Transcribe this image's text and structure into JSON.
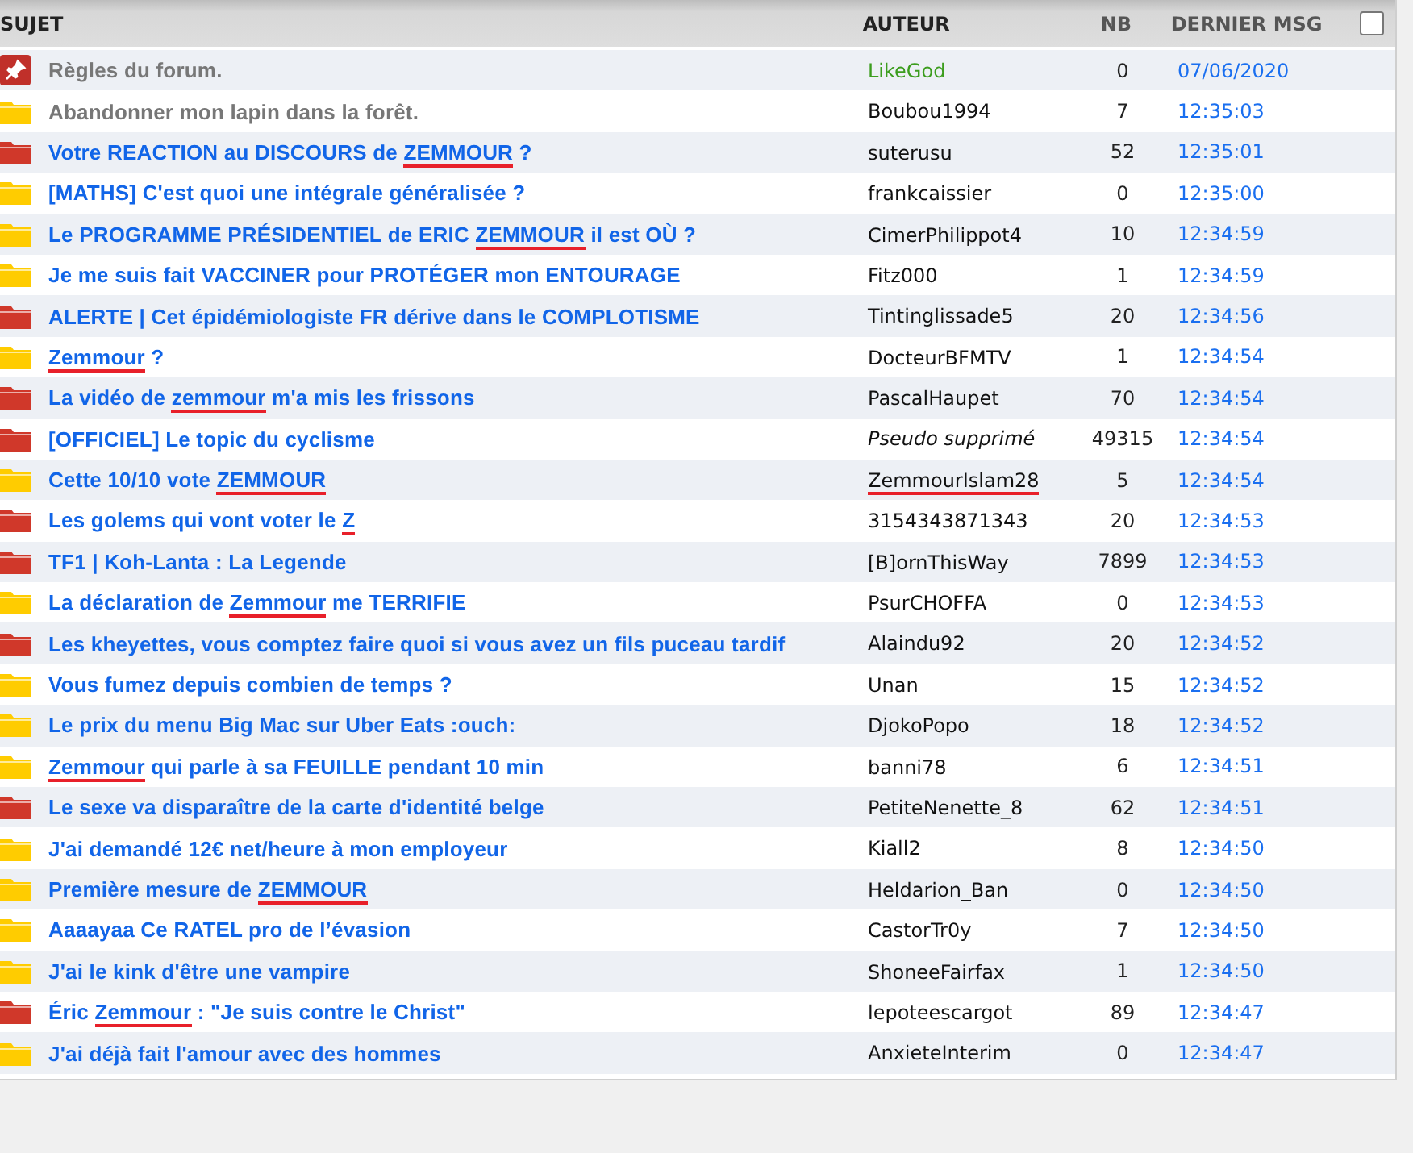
{
  "table": {
    "columns": [
      "SUJET",
      "AUTEUR",
      "NB",
      "DERNIER MSG"
    ],
    "select_all": {
      "checked": false
    },
    "rows": [
      {
        "kind": "pinned",
        "muted": true,
        "title": [
          {
            "text": "Règles du forum.",
            "flagged": false
          }
        ],
        "author": "LikeGod",
        "author_admin": true,
        "author_deleted": false,
        "author_flagged": false,
        "count": "0",
        "last": "07/06/2020"
      },
      {
        "kind": "folder_yellow",
        "muted": true,
        "title": [
          {
            "text": "Abandonner mon lapin dans la forêt.",
            "flagged": false
          }
        ],
        "author": "Boubou1994",
        "author_admin": false,
        "author_deleted": false,
        "author_flagged": false,
        "count": "7",
        "last": "12:35:03"
      },
      {
        "kind": "folder_red",
        "muted": false,
        "title": [
          {
            "text": "Votre REACTION au DISCOURS de ",
            "flagged": false
          },
          {
            "text": "ZEMMOUR",
            "flagged": true
          },
          {
            "text": " ?",
            "flagged": false
          }
        ],
        "author": "suterusu",
        "author_admin": false,
        "author_deleted": false,
        "author_flagged": false,
        "count": "52",
        "last": "12:35:01"
      },
      {
        "kind": "folder_yellow",
        "muted": false,
        "title": [
          {
            "text": "[MATHS] C'est quoi une intégrale généralisée ?",
            "flagged": false
          }
        ],
        "author": "frankcaissier",
        "author_admin": false,
        "author_deleted": false,
        "author_flagged": false,
        "count": "0",
        "last": "12:35:00"
      },
      {
        "kind": "folder_yellow",
        "muted": false,
        "title": [
          {
            "text": "Le PROGRAMME PRÉSIDENTIEL de ERIC ",
            "flagged": false
          },
          {
            "text": "ZEMMOUR",
            "flagged": true
          },
          {
            "text": " il est OÙ ?",
            "flagged": false
          }
        ],
        "author": "CimerPhilippot4",
        "author_admin": false,
        "author_deleted": false,
        "author_flagged": false,
        "count": "10",
        "last": "12:34:59"
      },
      {
        "kind": "folder_yellow",
        "muted": false,
        "title": [
          {
            "text": "Je me suis fait VACCINER pour PROTÉGER mon ENTOURAGE",
            "flagged": false
          }
        ],
        "author": "Fitz000",
        "author_admin": false,
        "author_deleted": false,
        "author_flagged": false,
        "count": "1",
        "last": "12:34:59"
      },
      {
        "kind": "folder_red",
        "muted": false,
        "title": [
          {
            "text": "ALERTE | Cet épidémiologiste FR dérive dans le COMPLOTISME",
            "flagged": false
          }
        ],
        "author": "Tintinglissade5",
        "author_admin": false,
        "author_deleted": false,
        "author_flagged": false,
        "count": "20",
        "last": "12:34:56"
      },
      {
        "kind": "folder_yellow",
        "muted": false,
        "title": [
          {
            "text": "Zemmour",
            "flagged": true
          },
          {
            "text": " ?",
            "flagged": false
          }
        ],
        "author": "DocteurBFMTV",
        "author_admin": false,
        "author_deleted": false,
        "author_flagged": false,
        "count": "1",
        "last": "12:34:54"
      },
      {
        "kind": "folder_red",
        "muted": false,
        "title": [
          {
            "text": "La vidéo de ",
            "flagged": false
          },
          {
            "text": "zemmour",
            "flagged": true
          },
          {
            "text": " m'a mis les frissons",
            "flagged": false
          }
        ],
        "author": "PascalHaupet",
        "author_admin": false,
        "author_deleted": false,
        "author_flagged": false,
        "count": "70",
        "last": "12:34:54"
      },
      {
        "kind": "folder_red",
        "muted": false,
        "title": [
          {
            "text": "[OFFICIEL] Le topic du cyclisme",
            "flagged": false
          }
        ],
        "author": "Pseudo supprimé",
        "author_admin": false,
        "author_deleted": true,
        "author_flagged": false,
        "count": "49315",
        "last": "12:34:54"
      },
      {
        "kind": "folder_yellow",
        "muted": false,
        "title": [
          {
            "text": "Cette 10/10 vote ",
            "flagged": false
          },
          {
            "text": "ZEMMOUR",
            "flagged": true
          }
        ],
        "author": "ZemmourIslam28",
        "author_admin": false,
        "author_deleted": false,
        "author_flagged": true,
        "count": "5",
        "last": "12:34:54"
      },
      {
        "kind": "folder_red",
        "muted": false,
        "title": [
          {
            "text": "Les golems qui vont voter le ",
            "flagged": false
          },
          {
            "text": "Z",
            "flagged": true
          }
        ],
        "author": "3154343871343",
        "author_admin": false,
        "author_deleted": false,
        "author_flagged": false,
        "count": "20",
        "last": "12:34:53"
      },
      {
        "kind": "folder_red",
        "muted": false,
        "title": [
          {
            "text": "TF1 | Koh-Lanta : La Legende",
            "flagged": false
          }
        ],
        "author": "[B]ornThisWay",
        "author_admin": false,
        "author_deleted": false,
        "author_flagged": false,
        "count": "7899",
        "last": "12:34:53"
      },
      {
        "kind": "folder_yellow",
        "muted": false,
        "title": [
          {
            "text": "La déclaration de ",
            "flagged": false
          },
          {
            "text": "Zemmour",
            "flagged": true
          },
          {
            "text": " me TERRIFIE",
            "flagged": false
          }
        ],
        "author": "PsurCHOFFA",
        "author_admin": false,
        "author_deleted": false,
        "author_flagged": false,
        "count": "0",
        "last": "12:34:53"
      },
      {
        "kind": "folder_red",
        "muted": false,
        "title": [
          {
            "text": "Les kheyettes, vous comptez faire quoi si vous avez un fils puceau tardif",
            "flagged": false
          }
        ],
        "author": "Alaindu92",
        "author_admin": false,
        "author_deleted": false,
        "author_flagged": false,
        "count": "20",
        "last": "12:34:52"
      },
      {
        "kind": "folder_yellow",
        "muted": false,
        "title": [
          {
            "text": "Vous fumez depuis combien de temps ?",
            "flagged": false
          }
        ],
        "author": "Unan",
        "author_admin": false,
        "author_deleted": false,
        "author_flagged": false,
        "count": "15",
        "last": "12:34:52"
      },
      {
        "kind": "folder_yellow",
        "muted": false,
        "title": [
          {
            "text": "Le prix du menu Big Mac sur Uber Eats :ouch:",
            "flagged": false
          }
        ],
        "author": "DjokoPopo",
        "author_admin": false,
        "author_deleted": false,
        "author_flagged": false,
        "count": "18",
        "last": "12:34:52"
      },
      {
        "kind": "folder_yellow",
        "muted": false,
        "title": [
          {
            "text": "Zemmour",
            "flagged": true
          },
          {
            "text": " qui parle à sa FEUILLE pendant 10 min",
            "flagged": false
          }
        ],
        "author": "banni78",
        "author_admin": false,
        "author_deleted": false,
        "author_flagged": false,
        "count": "6",
        "last": "12:34:51"
      },
      {
        "kind": "folder_red",
        "muted": false,
        "title": [
          {
            "text": "Le sexe va disparaître de la carte d'identité belge",
            "flagged": false
          }
        ],
        "author": "PetiteNenette_8",
        "author_admin": false,
        "author_deleted": false,
        "author_flagged": false,
        "count": "62",
        "last": "12:34:51"
      },
      {
        "kind": "folder_yellow",
        "muted": false,
        "title": [
          {
            "text": "J'ai demandé 12€ net/heure à mon employeur",
            "flagged": false
          }
        ],
        "author": "Kiall2",
        "author_admin": false,
        "author_deleted": false,
        "author_flagged": false,
        "count": "8",
        "last": "12:34:50"
      },
      {
        "kind": "folder_yellow",
        "muted": false,
        "title": [
          {
            "text": "Première mesure de ",
            "flagged": false
          },
          {
            "text": "ZEMMOUR",
            "flagged": true
          }
        ],
        "author": "Heldarion_Ban",
        "author_admin": false,
        "author_deleted": false,
        "author_flagged": false,
        "count": "0",
        "last": "12:34:50"
      },
      {
        "kind": "folder_yellow",
        "muted": false,
        "title": [
          {
            "text": "Aaaayaa Ce RATEL pro de l’évasion",
            "flagged": false
          }
        ],
        "author": "CastorTr0y",
        "author_admin": false,
        "author_deleted": false,
        "author_flagged": false,
        "count": "7",
        "last": "12:34:50"
      },
      {
        "kind": "folder_yellow",
        "muted": false,
        "title": [
          {
            "text": "J'ai le kink d'être une vampire",
            "flagged": false
          }
        ],
        "author": "ShoneeFairfax",
        "author_admin": false,
        "author_deleted": false,
        "author_flagged": false,
        "count": "1",
        "last": "12:34:50"
      },
      {
        "kind": "folder_red",
        "muted": false,
        "title": [
          {
            "text": "Éric ",
            "flagged": false
          },
          {
            "text": "Zemmour",
            "flagged": true
          },
          {
            "text": " : \"Je suis contre le Christ\"",
            "flagged": false
          }
        ],
        "author": "lepoteescargot",
        "author_admin": false,
        "author_deleted": false,
        "author_flagged": false,
        "count": "89",
        "last": "12:34:47"
      },
      {
        "kind": "folder_yellow",
        "muted": false,
        "title": [
          {
            "text": "J'ai déjà fait l'amour avec des hommes",
            "flagged": false
          }
        ],
        "author": "AnxieteInterim",
        "author_admin": false,
        "author_deleted": false,
        "author_flagged": false,
        "count": "0",
        "last": "12:34:47"
      }
    ]
  }
}
